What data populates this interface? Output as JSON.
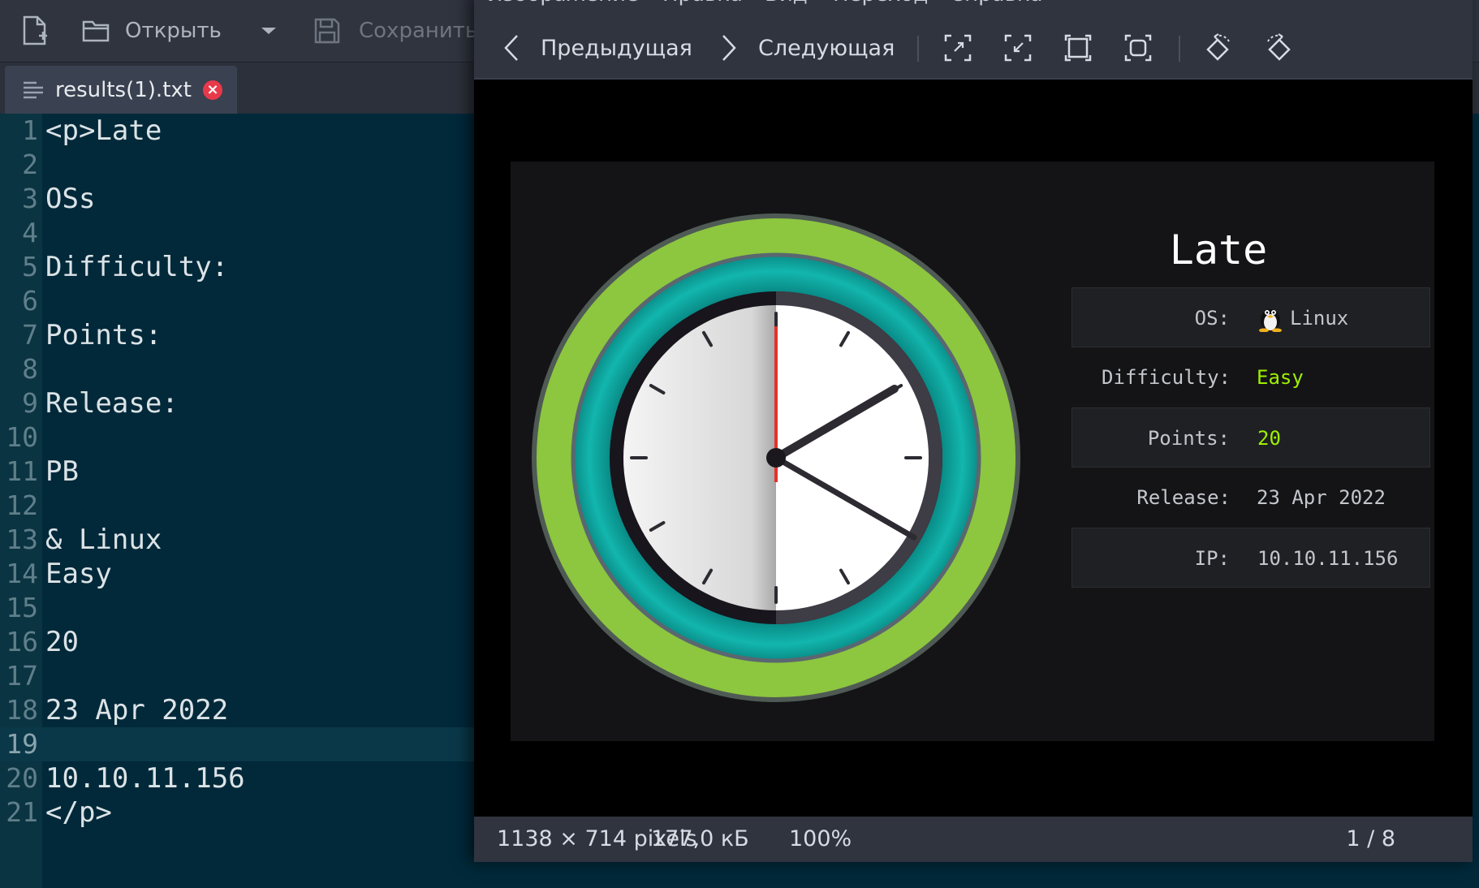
{
  "editor": {
    "toolbar": {
      "open_label": "Открыть",
      "save_label": "Сохранить"
    },
    "tab": {
      "filename": "results(1).txt",
      "close_glyph": "×"
    },
    "lines": [
      {
        "n": "1",
        "text": "<p>Late"
      },
      {
        "n": "2",
        "text": ""
      },
      {
        "n": "3",
        "text": "OSs"
      },
      {
        "n": "4",
        "text": ""
      },
      {
        "n": "5",
        "text": "Difficulty:"
      },
      {
        "n": "6",
        "text": ""
      },
      {
        "n": "7",
        "text": "Points:"
      },
      {
        "n": "8",
        "text": ""
      },
      {
        "n": "9",
        "text": "Release:"
      },
      {
        "n": "10",
        "text": ""
      },
      {
        "n": "11",
        "text": "PB"
      },
      {
        "n": "12",
        "text": ""
      },
      {
        "n": "13",
        "text": "& Linux"
      },
      {
        "n": "14",
        "text": "Easy"
      },
      {
        "n": "15",
        "text": ""
      },
      {
        "n": "16",
        "text": "20"
      },
      {
        "n": "17",
        "text": ""
      },
      {
        "n": "18",
        "text": "23 Apr 2022"
      },
      {
        "n": "19",
        "text": ""
      },
      {
        "n": "20",
        "text": "10.10.11.156"
      },
      {
        "n": "21",
        "text": "</p>"
      }
    ],
    "current_line": "19"
  },
  "viewer": {
    "menu": [
      "Изображение",
      "Правка",
      "Вид",
      "Переход",
      "Справка"
    ],
    "toolbar": {
      "prev_label": "Предыдущая",
      "next_label": "Следующая"
    },
    "status": {
      "dimensions": "1138 × 714 pixels",
      "size": "177,0 кБ",
      "zoom": "100%",
      "position": "1 / 8"
    }
  },
  "card": {
    "title": "Late",
    "rows": [
      {
        "label": "OS:",
        "value": "Linux"
      },
      {
        "label": "Difficulty:",
        "value": "Easy"
      },
      {
        "label": "Points:",
        "value": "20"
      },
      {
        "label": "Release:",
        "value": "23 Apr 2022"
      },
      {
        "label": "IP:",
        "value": "10.10.11.156"
      }
    ],
    "colors": {
      "accent_green": "#9fef00",
      "ring_green": "#8dc63f",
      "ring_teal": "#0aa9a0"
    }
  }
}
